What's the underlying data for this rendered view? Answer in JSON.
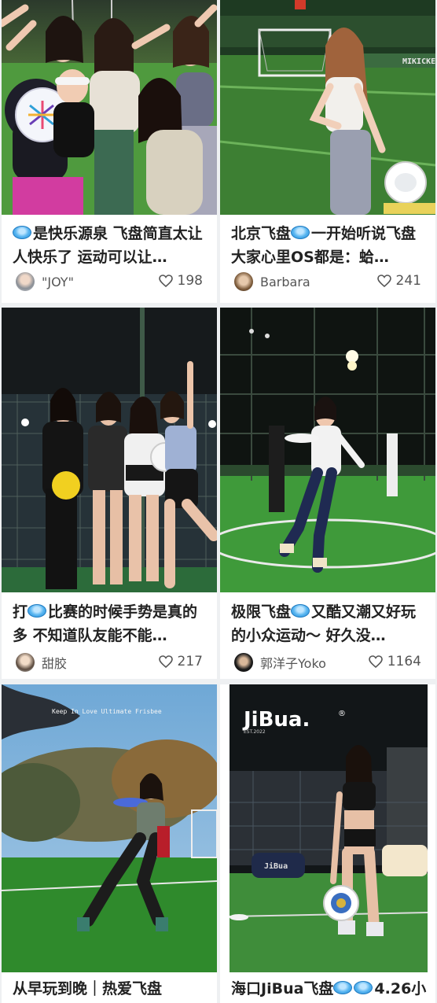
{
  "cards": [
    {
      "title_prefix": "",
      "title": "是快乐源泉 飞盘简直太让人快乐了 运动可以让…",
      "author": "\"JOY\"",
      "likes": "198"
    },
    {
      "title": "北京飞盘",
      "title_after_icon": "一开始听说飞盘大家心里OS都是：蛤…",
      "author": "Barbara",
      "likes": "241"
    },
    {
      "title_lead": "打",
      "title": "比赛的时候手势是真的多 不知道队友能不能…",
      "author": "甜胶",
      "likes": "217"
    },
    {
      "title": "极限飞盘",
      "title_after_icon": "又酷又潮又好玩的小众运动～ 好久没…",
      "author": "郭洋子Yoko",
      "likes": "1164"
    },
    {
      "title": "从早玩到晚｜热爱飞盘"
    },
    {
      "title": "海口JiBua飞盘",
      "title_after_icon": "4.26小"
    }
  ],
  "photo_text": {
    "jibua_logo": "JiBua.",
    "jibua_registered": "®",
    "jibua_sub": "EST.2022",
    "field_banner": "MIKICKER",
    "day_caption": "Keep In Love Ultimate Frisbee",
    "disc_logo": "JiBua"
  },
  "colors": {
    "disc_blue": "#56b4f0",
    "accent_grass": "#3f9a3a"
  }
}
